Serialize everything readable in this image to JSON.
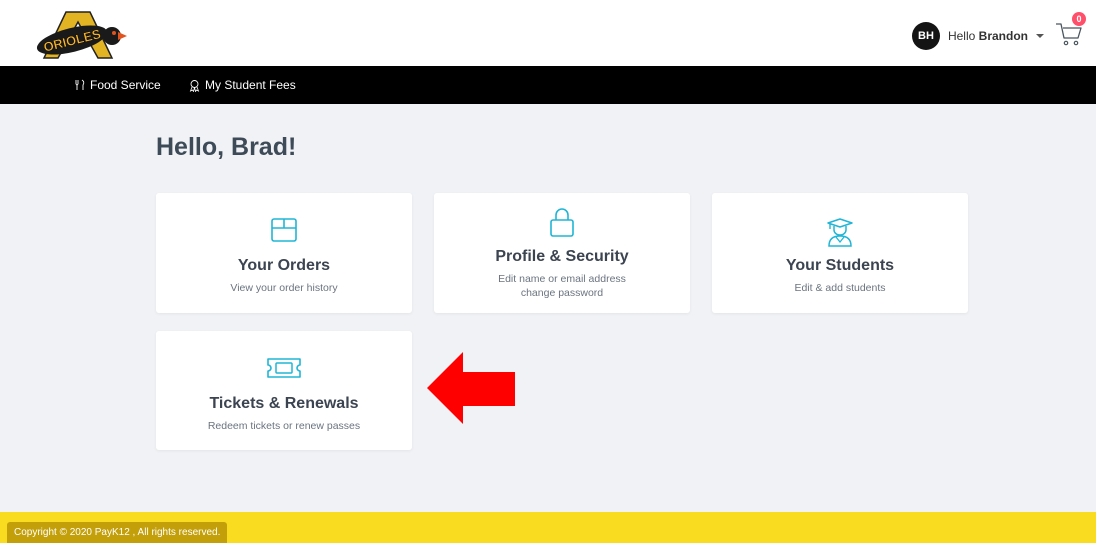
{
  "header": {
    "logo_text": "ORIOLES",
    "user": {
      "initials": "BH",
      "greeting": "Hello ",
      "name": "Brandon"
    },
    "cart": {
      "count": "0"
    }
  },
  "nav": {
    "items": [
      {
        "label": "Food Service",
        "icon": "utensils-icon"
      },
      {
        "label": "My Student Fees",
        "icon": "ribbon-icon"
      }
    ]
  },
  "main": {
    "greeting": "Hello, Brad!",
    "cards": [
      {
        "title": "Your Orders",
        "subtitle": [
          "View your order history"
        ],
        "icon": "box-icon"
      },
      {
        "title": "Profile & Security",
        "subtitle": [
          "Edit name or email address",
          "change password"
        ],
        "icon": "lock-icon"
      },
      {
        "title": "Your Students",
        "subtitle": [
          "Edit & add students"
        ],
        "icon": "student-icon"
      },
      {
        "title": "Tickets & Renewals",
        "subtitle": [
          "Redeem tickets or renew passes"
        ],
        "icon": "ticket-icon"
      }
    ]
  },
  "annotation": {
    "color": "#ff0000",
    "icon": "left-arrow-icon"
  },
  "footer": {
    "copyright": "Copyright © 2020 PayK12 , All rights reserved."
  },
  "colors": {
    "accent": "#1fb5d6",
    "footer": "#f9dc1f",
    "footer_badge": "#c39f09",
    "nav": "#000000",
    "badge": "#ff4f6a"
  }
}
